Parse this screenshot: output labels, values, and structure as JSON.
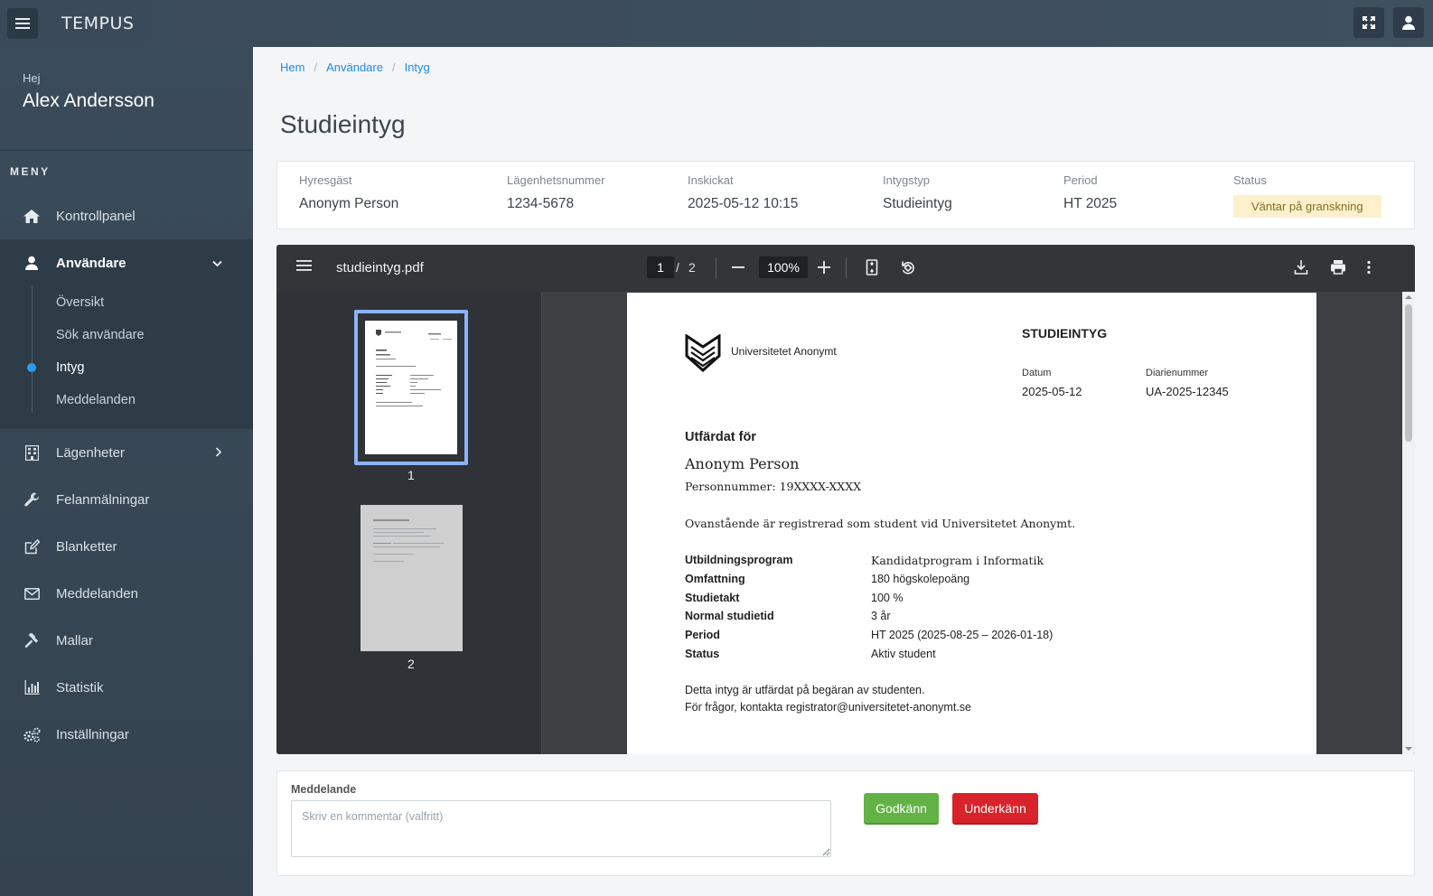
{
  "app": {
    "logo": "TEMPUS"
  },
  "sidebar": {
    "greeting": "Hej",
    "user_name": "Alex Andersson",
    "menu_heading": "MENY",
    "items": [
      {
        "label": "Kontrollpanel",
        "icon": "home-icon"
      },
      {
        "label": "Användare",
        "icon": "user-icon",
        "expanded": true,
        "children": [
          {
            "label": "Översikt"
          },
          {
            "label": "Sök användare"
          },
          {
            "label": "Intyg",
            "active": true
          },
          {
            "label": "Meddelanden"
          }
        ]
      },
      {
        "label": "Lägenheter",
        "icon": "building-icon"
      },
      {
        "label": "Felanmälningar",
        "icon": "wrench-icon"
      },
      {
        "label": "Blanketter",
        "icon": "edit-form-icon"
      },
      {
        "label": "Meddelanden",
        "icon": "envelope-icon"
      },
      {
        "label": "Mallar",
        "icon": "gavel-icon"
      },
      {
        "label": "Statistik",
        "icon": "bar-chart-icon"
      },
      {
        "label": "Inställningar",
        "icon": "gears-icon"
      }
    ]
  },
  "breadcrumb": [
    "Hem",
    "Användare",
    "Intyg"
  ],
  "page_title": "Studieintyg",
  "info": {
    "tenant_label": "Hyresgäst",
    "tenant": "Anonym Person",
    "apartment_label": "Lägenhetsnummer",
    "apartment": "1234-5678",
    "submitted_label": "Inskickat",
    "submitted": "2025-05-12 10:15",
    "type_label": "Intygstyp",
    "type": "Studieintyg",
    "period_label": "Period",
    "period": "HT 2025",
    "status_label": "Status",
    "status": "Väntar på granskning"
  },
  "viewer": {
    "filename": "studieintyg.pdf",
    "current_page": "1",
    "page_sep": "/",
    "total_pages": "2",
    "zoom": "100%",
    "thumbs": [
      "1",
      "2"
    ]
  },
  "document": {
    "university": "Universitetet Anonymt",
    "title": "STUDIEINTYG",
    "date_label": "Datum",
    "date": "2025-05-12",
    "reg_label": "Diarienummer",
    "reg": "UA-2025-12345",
    "issued_for": "Utfärdat för",
    "person": "Anonym Person",
    "personnr": "Personnummer: 19XXXX-XXXX",
    "statement": "Ovanstående är registrerad som student vid Universitetet Anonymt.",
    "rows": [
      {
        "label": "Utbildningsprogram",
        "value": "Kandidatprogram i Informatik"
      },
      {
        "label": "Omfattning",
        "value": "180 högskolepoäng"
      },
      {
        "label": "Studietakt",
        "value": "100 %"
      },
      {
        "label": "Normal studietid",
        "value": "3 år"
      },
      {
        "label": "Period",
        "value": "HT 2025 (2025-08-25 – 2026-01-18)"
      },
      {
        "label": "Status",
        "value": "Aktiv student"
      }
    ],
    "footer1": "Detta intyg är utfärdat på begäran av studenten.",
    "footer2": "För frågor, kontakta registrator@universitetet-anonymt.se"
  },
  "message": {
    "label": "Meddelande",
    "placeholder": "Skriv en kommentar (valfritt)",
    "value": "",
    "approve_label": "Godkänn",
    "reject_label": "Underkänn"
  },
  "colors": {
    "accent": "#2d9cf0",
    "approve": "#62b246",
    "reject": "#d8232a",
    "status_badge_bg": "#fdf0cd"
  }
}
